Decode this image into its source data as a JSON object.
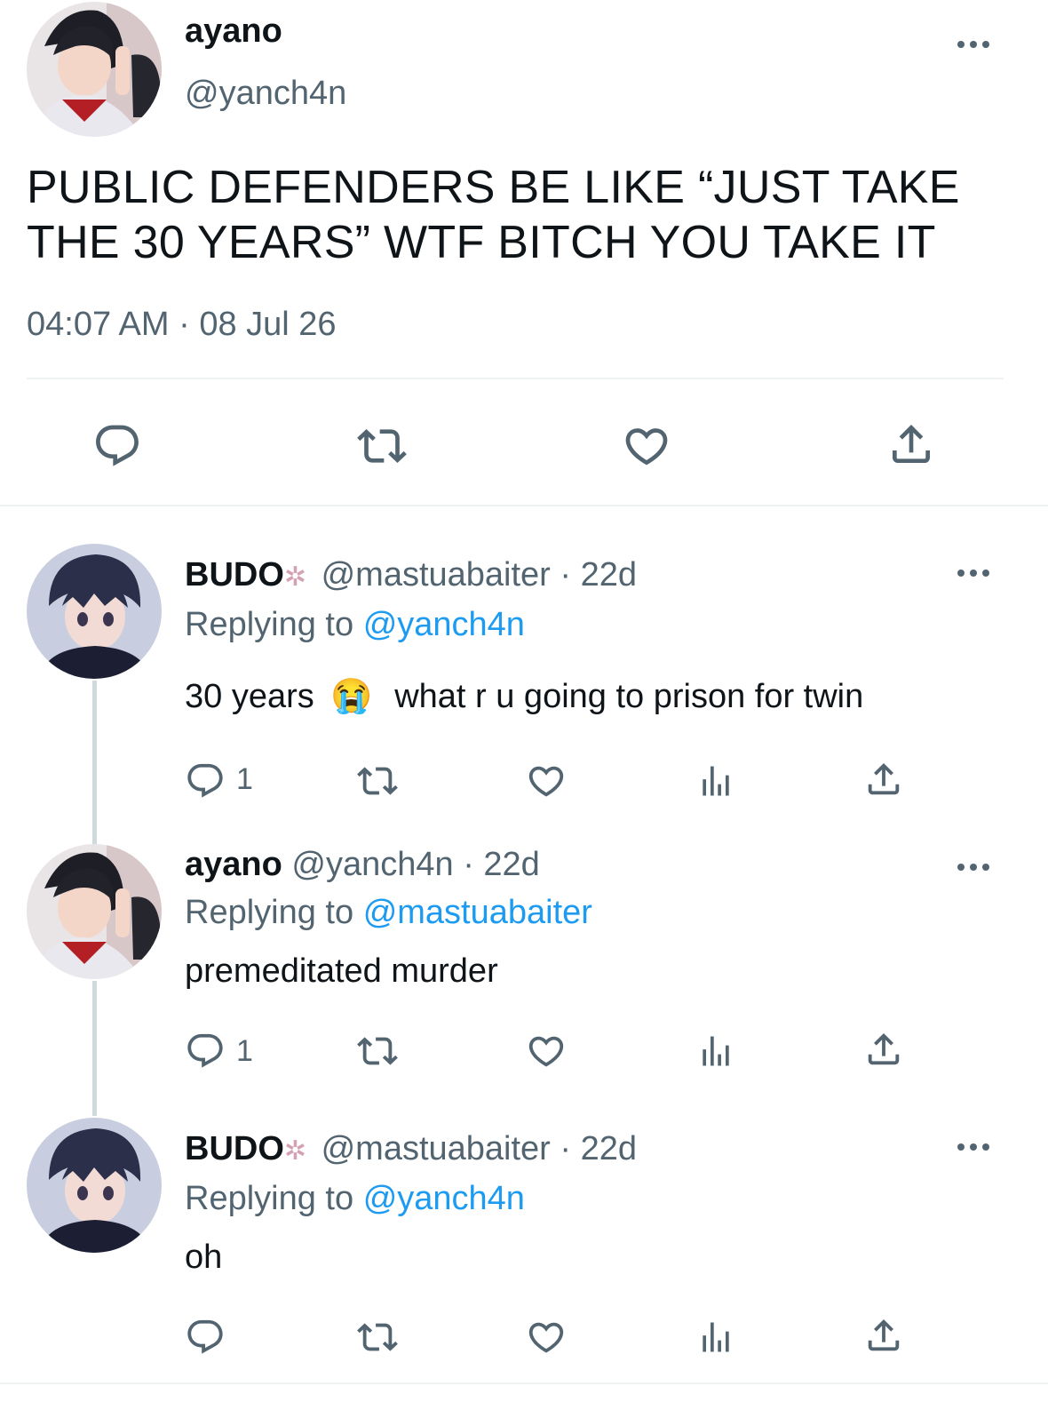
{
  "main_tweet": {
    "display_name": "ayano",
    "handle": "@yanch4n",
    "text_line1": "PUBLIC DEFENDERS BE LIKE “JUST TAKE",
    "text_line2": "THE 30 YEARS” WTF BITCH YOU TAKE IT",
    "timestamp": "04:07 AM · 08 Jul 26"
  },
  "replies": [
    {
      "display_name": "BUDO",
      "handle_time": "@mastuabaiter · 22d",
      "replying_prefix": "Replying to",
      "replying_to": "@yanch4n",
      "text_before_emoji": "30 years",
      "emoji": "😭",
      "text_after_emoji": "what r u going to prison for twin",
      "reply_count": "1"
    },
    {
      "display_name": "ayano",
      "handle_time": "@yanch4n · 22d",
      "replying_prefix": "Replying to",
      "replying_to": "@mastuabaiter",
      "text": "premeditated murder",
      "reply_count": "1"
    },
    {
      "display_name": "BUDO",
      "handle_time": "@mastuabaiter · 22d",
      "replying_prefix": "Replying to",
      "replying_to": "@yanch4n",
      "text": "oh"
    }
  ],
  "icons": {
    "reply": "reply-icon",
    "retweet": "retweet-icon",
    "like": "heart-icon",
    "views": "views-icon",
    "share": "share-icon",
    "more": "more-icon",
    "badge": "sparkle-badge-icon"
  },
  "colors": {
    "link": "#1d9bf0",
    "secondary_text": "#536471",
    "divider": "#eff3f4",
    "thread_line": "#cfd9de"
  }
}
